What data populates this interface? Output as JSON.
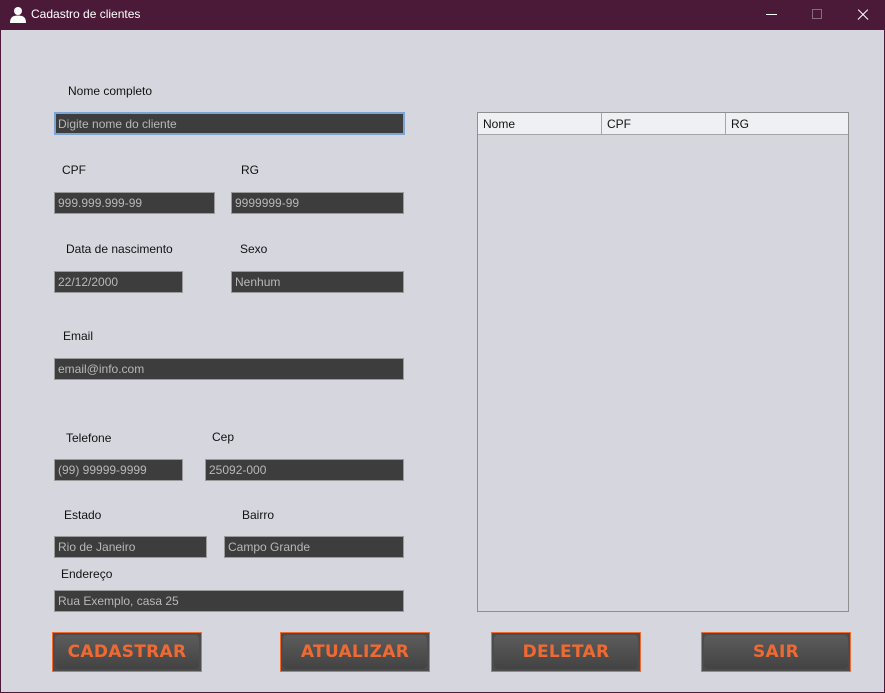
{
  "window": {
    "title": "Cadastro de clientes",
    "icon": "user-icon",
    "controls": [
      "minimize-icon",
      "maximize-icon",
      "close-icon"
    ]
  },
  "form": {
    "nome": {
      "label": "Nome completo",
      "value": "Digite nome do cliente"
    },
    "cpf": {
      "label": "CPF",
      "value": "999.999.999-99"
    },
    "rg": {
      "label": "RG",
      "value": "9999999-99"
    },
    "nascimento": {
      "label": "Data de nascimento",
      "value": "22/12/2000"
    },
    "sexo": {
      "label": "Sexo",
      "value": "Nenhum"
    },
    "email": {
      "label": "Email",
      "value": "email@info.com"
    },
    "telefone": {
      "label": "Telefone",
      "value": "(99) 99999-9999"
    },
    "cep": {
      "label": "Cep",
      "value": "25092-000"
    },
    "estado": {
      "label": "Estado",
      "value": "Rio de Janeiro"
    },
    "bairro": {
      "label": "Bairro",
      "value": "Campo Grande"
    },
    "endereco": {
      "label": "Endereço",
      "value": "Rua Exemplo, casa 25"
    }
  },
  "table": {
    "columns": [
      "Nome",
      "CPF",
      "RG"
    ],
    "rows": []
  },
  "buttons": {
    "cadastrar": "CADASTRAR",
    "atualizar": "ATUALIZAR",
    "deletar": "DELETAR",
    "sair": "SAIR"
  },
  "colors": {
    "titlebar": "#4a1a38",
    "background": "#d6d7de",
    "field_bg": "#3d3d3d",
    "button_text": "#ef6a33",
    "button_border": "#f06a35"
  }
}
